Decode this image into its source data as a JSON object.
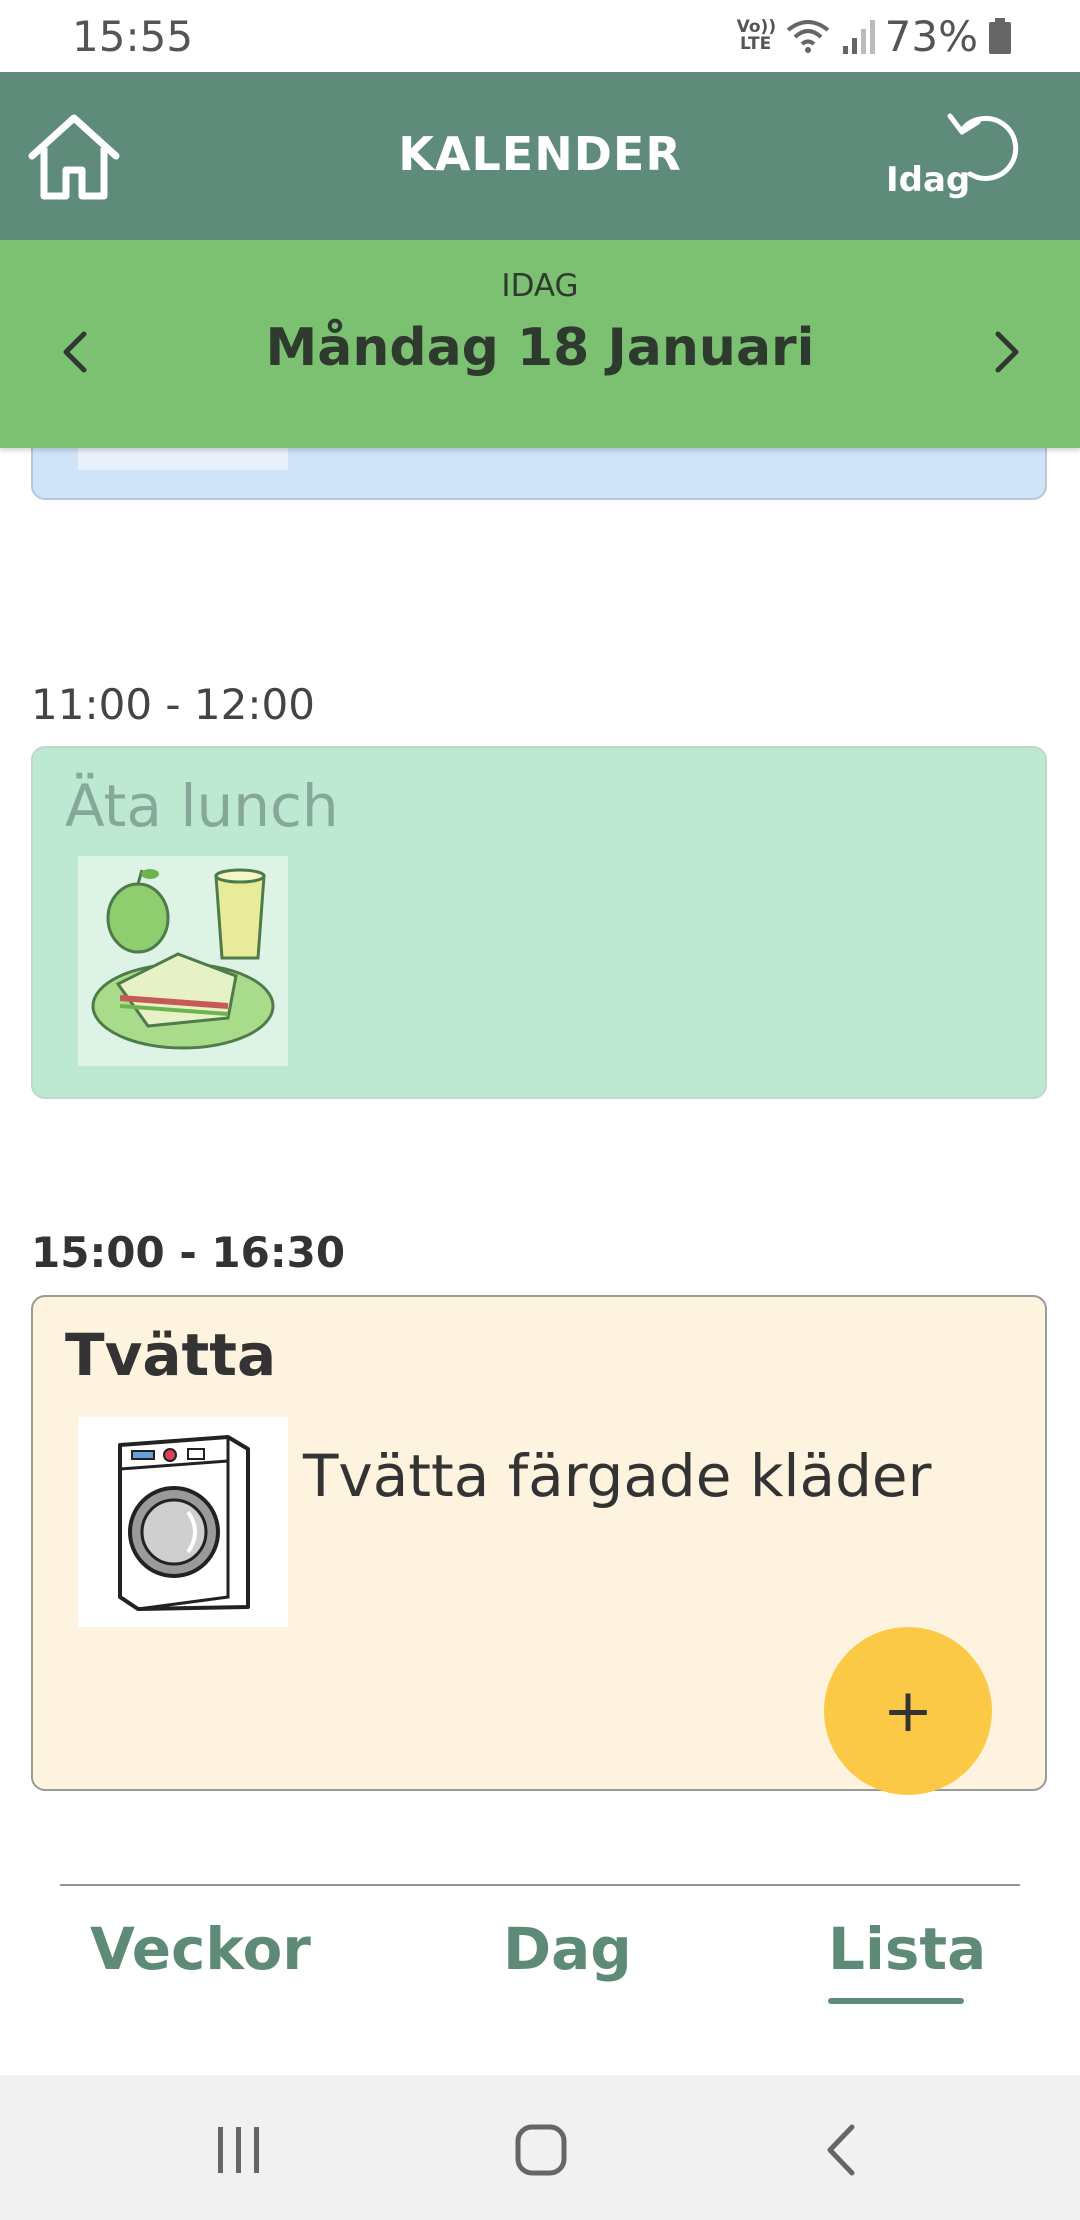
{
  "status_bar": {
    "time": "15:55",
    "volte_top": "Vo))",
    "volte_bottom": "LTE",
    "battery": "73%",
    "icons": [
      "wifi-icon",
      "signal-icon",
      "battery-icon"
    ]
  },
  "header": {
    "title": "KALENDER",
    "today_label": "Idag",
    "icons": [
      "home-icon",
      "refresh-icon"
    ],
    "color": "#5f8b7a"
  },
  "date_band": {
    "subtitle": "IDAG",
    "date": "Måndag 18 Januari",
    "icons": [
      "chevron-left-icon",
      "chevron-right-icon"
    ],
    "color": "#7cc072"
  },
  "events": [
    {
      "time": "",
      "title": "",
      "color": "#cfe4f8",
      "icon": "building-icon"
    },
    {
      "time": "11:00 - 12:00",
      "title": "Äta lunch",
      "color": "#bde9d2",
      "icon": "lunch-icon"
    },
    {
      "time": "15:00 - 16:30",
      "title": "Tvätta",
      "description": "Tvätta färgade kläder",
      "color": "#fdf3df",
      "icon": "washing-machine-icon",
      "add_label": "+"
    }
  ],
  "tabs": [
    {
      "label": "Veckor",
      "active": false
    },
    {
      "label": "Dag",
      "active": false
    },
    {
      "label": "Lista",
      "active": true
    }
  ],
  "system_nav": {
    "icons": [
      "recent-apps-icon",
      "home-circle-icon",
      "back-icon"
    ]
  }
}
